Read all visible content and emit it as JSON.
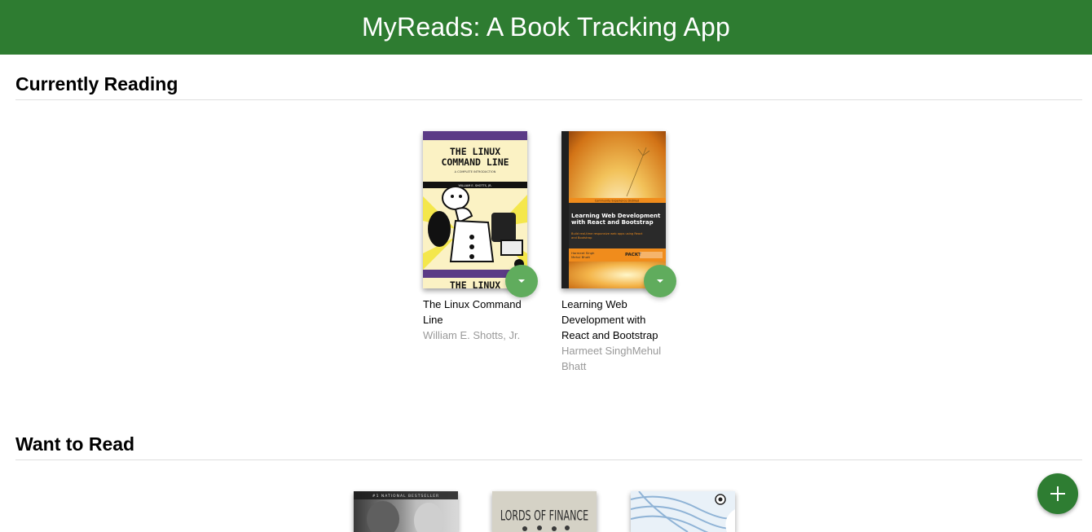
{
  "header": {
    "title": "MyReads: A Book Tracking App"
  },
  "shelves": [
    {
      "title": "Currently Reading",
      "books": [
        {
          "title": "The Linux Command Line",
          "authors": "William E. Shotts, Jr.",
          "cover_text": {
            "line1": "THE LINUX",
            "line2": "COMMAND LINE",
            "subtitle": "A COMPLETE INTRODUCTION",
            "author": "WILLIAM E. SHOTTS, JR.",
            "bottom": "THE LINUX"
          }
        },
        {
          "title": "Learning Web Development with React and Bootstrap",
          "authors": "Harmeet SinghMehul Bhatt",
          "cover_text": {
            "banner": "Community Experience Distilled",
            "title1": "Learning Web Development",
            "title2": "with React and Bootstrap",
            "tag1": "Build real-time responsive web apps using React",
            "tag2": "and Bootstrap",
            "author1": "Harmeet Singh",
            "author2": "Mehul Bhatt",
            "publisher": "PACKT"
          }
        }
      ]
    },
    {
      "title": "Want to Read",
      "books": [
        {
          "cover_text": {
            "top": "#1 NATIONAL BESTSELLER"
          }
        },
        {
          "cover_text": {
            "top": "LORDS OF FINANCE"
          }
        },
        {
          "cover_text": {}
        }
      ]
    }
  ],
  "colors": {
    "header": "#2e7c31",
    "shelf_changer": "#60ac5d",
    "add_button": "#2e7d32"
  },
  "icons": {
    "shelf_changer": "caret-down-icon",
    "add": "plus-icon"
  }
}
